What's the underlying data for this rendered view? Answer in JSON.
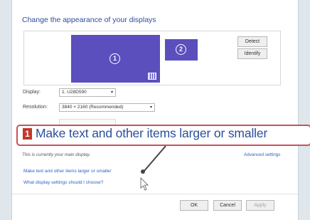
{
  "window": {
    "title": "Change the appearance of your displays"
  },
  "preview": {
    "monitor1_badge": "1",
    "monitor2_badge": "2",
    "monitor_color": "#5b4fbd",
    "detect_label": "Detect",
    "identify_label": "Identify"
  },
  "settings": {
    "display_label": "Display:",
    "display_value": "1. U28D590",
    "resolution_label": "Resolution:",
    "resolution_value": "3840 × 2160 (Recommended)"
  },
  "callout": {
    "number": "1",
    "text": "Make text and other items larger or smaller",
    "border_color": "#c8515c"
  },
  "info": {
    "main_display_note": "This is currently your main display.",
    "advanced_settings_link": "Advanced settings",
    "make_text_link": "Make text and other items larger or smaller",
    "what_settings_link": "What display settings should I choose?"
  },
  "footer": {
    "ok_label": "OK",
    "cancel_label": "Cancel",
    "apply_label": "Apply"
  },
  "icons": {
    "dropdown_arrow": "chevron-down-icon",
    "cursor": "mouse-pointer-icon",
    "grid": "display-grid-icon"
  }
}
